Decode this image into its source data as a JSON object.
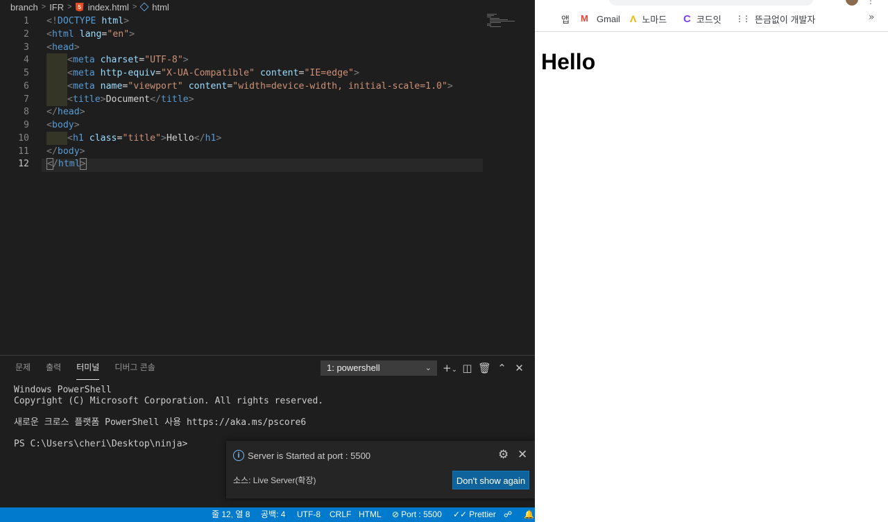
{
  "breadcrumb": {
    "items": [
      "branch",
      "IFR",
      "index.html",
      "html"
    ],
    "separator": ">"
  },
  "editor": {
    "line_numbers": [
      "1",
      "2",
      "3",
      "4",
      "5",
      "6",
      "7",
      "8",
      "9",
      "10",
      "11",
      "12"
    ],
    "active_line": "12",
    "lines": [
      [
        {
          "t": "<!",
          "c": "b"
        },
        {
          "t": "DOCTYPE",
          "c": "d"
        },
        {
          "t": " html",
          "c": "a"
        },
        {
          "t": ">",
          "c": "b"
        }
      ],
      [
        {
          "t": "<",
          "c": "b"
        },
        {
          "t": "html",
          "c": "t"
        },
        {
          "t": " lang",
          "c": "a"
        },
        {
          "t": "=",
          "c": "w"
        },
        {
          "t": "\"en\"",
          "c": "s"
        },
        {
          "t": ">",
          "c": "b"
        }
      ],
      [
        {
          "t": "<",
          "c": "b"
        },
        {
          "t": "head",
          "c": "t"
        },
        {
          "t": ">",
          "c": "b"
        }
      ],
      [
        {
          "indent": true
        },
        {
          "t": "<",
          "c": "b"
        },
        {
          "t": "meta",
          "c": "t"
        },
        {
          "t": " charset",
          "c": "a"
        },
        {
          "t": "=",
          "c": "w"
        },
        {
          "t": "\"UTF-8\"",
          "c": "s"
        },
        {
          "t": ">",
          "c": "b"
        }
      ],
      [
        {
          "indent": true
        },
        {
          "t": "<",
          "c": "b"
        },
        {
          "t": "meta",
          "c": "t"
        },
        {
          "t": " http-equiv",
          "c": "a"
        },
        {
          "t": "=",
          "c": "w"
        },
        {
          "t": "\"X-UA-Compatible\"",
          "c": "s"
        },
        {
          "t": " content",
          "c": "a"
        },
        {
          "t": "=",
          "c": "w"
        },
        {
          "t": "\"IE=edge\"",
          "c": "s"
        },
        {
          "t": ">",
          "c": "b"
        }
      ],
      [
        {
          "indent": true
        },
        {
          "t": "<",
          "c": "b"
        },
        {
          "t": "meta",
          "c": "t"
        },
        {
          "t": " name",
          "c": "a"
        },
        {
          "t": "=",
          "c": "w"
        },
        {
          "t": "\"viewport\"",
          "c": "s"
        },
        {
          "t": " content",
          "c": "a"
        },
        {
          "t": "=",
          "c": "w"
        },
        {
          "t": "\"width=device-width, initial-scale=1.0\"",
          "c": "s"
        },
        {
          "t": ">",
          "c": "b"
        }
      ],
      [
        {
          "indent": true
        },
        {
          "t": "<",
          "c": "b"
        },
        {
          "t": "title",
          "c": "t"
        },
        {
          "t": ">",
          "c": "b"
        },
        {
          "t": "Document",
          "c": "w"
        },
        {
          "t": "</",
          "c": "b"
        },
        {
          "t": "title",
          "c": "t"
        },
        {
          "t": ">",
          "c": "b"
        }
      ],
      [
        {
          "t": "</",
          "c": "b"
        },
        {
          "t": "head",
          "c": "t"
        },
        {
          "t": ">",
          "c": "b"
        }
      ],
      [
        {
          "t": "<",
          "c": "b"
        },
        {
          "t": "body",
          "c": "t"
        },
        {
          "t": ">",
          "c": "b"
        }
      ],
      [
        {
          "indent": true
        },
        {
          "t": "<",
          "c": "b"
        },
        {
          "t": "h1",
          "c": "t"
        },
        {
          "t": " class",
          "c": "a"
        },
        {
          "t": "=",
          "c": "w"
        },
        {
          "t": "\"title\"",
          "c": "s"
        },
        {
          "t": ">",
          "c": "b"
        },
        {
          "t": "Hello",
          "c": "w"
        },
        {
          "t": "</",
          "c": "b"
        },
        {
          "t": "h1",
          "c": "t"
        },
        {
          "t": ">",
          "c": "b"
        }
      ],
      [
        {
          "t": "</",
          "c": "b"
        },
        {
          "t": "body",
          "c": "t"
        },
        {
          "t": ">",
          "c": "b"
        }
      ],
      [
        {
          "t": "<",
          "c": "b",
          "box": true,
          "cursor": true
        },
        {
          "t": "/",
          "c": "b"
        },
        {
          "t": "html",
          "c": "t"
        },
        {
          "t": ">",
          "c": "b",
          "box": true
        }
      ]
    ]
  },
  "panel": {
    "tabs": [
      "문제",
      "출력",
      "터미널",
      "디버그 콘솔"
    ],
    "active_tab": "터미널",
    "terminal_select": "1: powershell",
    "terminal_lines": [
      "Windows PowerShell",
      "Copyright (C) Microsoft Corporation. All rights reserved.",
      "",
      "새로운 크로스 플랫폼 PowerShell 사용 https://aka.ms/pscore6",
      "",
      "PS C:\\Users\\cheri\\Desktop\\ninja>"
    ]
  },
  "notification": {
    "message": "Server is Started at port : 5500",
    "source": "소스: Live Server(확장)",
    "button": "Don't show again"
  },
  "status_bar": {
    "position": "줄 12, 열 8",
    "spaces": "공백: 4",
    "encoding": "UTF-8",
    "eol": "CRLF",
    "language": "HTML",
    "port": "Port : 5500",
    "prettier": "Prettier"
  },
  "browser": {
    "bookmarks": [
      "앱",
      "Gmail",
      "노마드",
      "코드잇",
      "뜬금없이 개발자"
    ],
    "more": "»",
    "page_heading": "Hello"
  },
  "colors": {
    "editor_bg": "#1e1e1e",
    "status_bg": "#007acc",
    "button_bg": "#0e639c",
    "tag": "#569cd6",
    "attr": "#9cdcfe",
    "string": "#ce9178"
  }
}
